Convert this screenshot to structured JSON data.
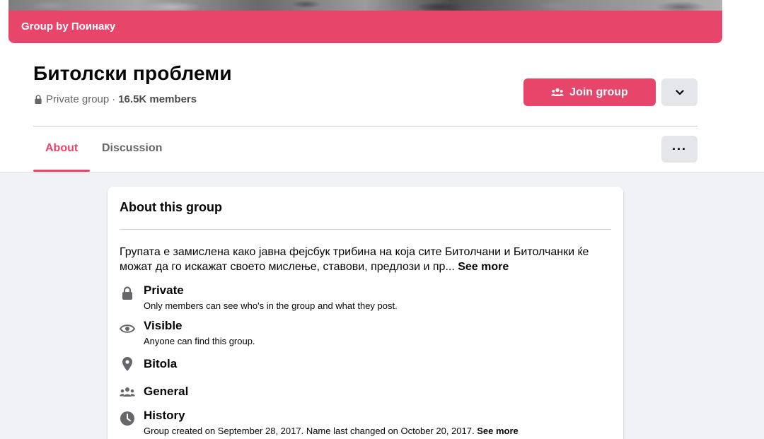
{
  "cover": {
    "banner_text": "Group by Поинаку"
  },
  "group": {
    "name": "Битолски проблеми",
    "privacy": "Private group",
    "separator": "·",
    "members": "16.5K members"
  },
  "actions": {
    "join_label": "Join group"
  },
  "tabs": [
    {
      "label": "About",
      "active": true
    },
    {
      "label": "Discussion",
      "active": false
    }
  ],
  "more_label": "···",
  "about": {
    "title": "About this group",
    "description": "Групата е замислена како јавна фејсбук трибина на која сите Битолчани и Битолчанки ќе можат да го искажат своето мислење, ставови, предлози и пр...",
    "see_more": "See more",
    "items": [
      {
        "icon": "lock-icon",
        "title": "Private",
        "subtitle": "Only members can see who's in the group and what they post."
      },
      {
        "icon": "eye-icon",
        "title": "Visible",
        "subtitle": "Anyone can find this group."
      },
      {
        "icon": "location-pin-icon",
        "title": "Bitola",
        "subtitle": ""
      },
      {
        "icon": "people-icon",
        "title": "General",
        "subtitle": ""
      },
      {
        "icon": "clock-icon",
        "title": "History",
        "subtitle": "Group created on September 28, 2017. Name last changed on October 20, 2017.",
        "see_more": "See more"
      }
    ]
  },
  "colors": {
    "accent": "#e8456a",
    "page_bg": "#f0f2f5",
    "icon_gray": "#65676b",
    "button_gray": "#e4e6eb"
  }
}
